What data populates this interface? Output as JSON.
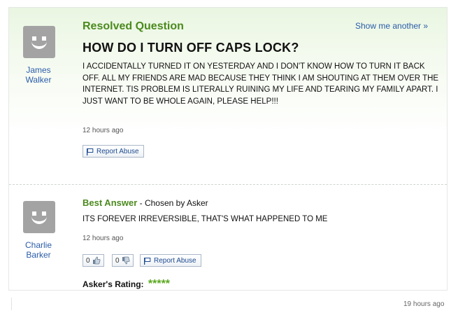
{
  "question": {
    "status_label": "Resolved Question",
    "show_another": "Show me another »",
    "asker": "James Walker",
    "title": "HOW DO I TURN OFF CAPS LOCK?",
    "body": "I ACCIDENTALLY TURNED IT ON YESTERDAY AND I DON'T KNOW HOW TO TURN IT BACK OFF. ALL MY FRIENDS ARE MAD BECAUSE THEY THINK I AM SHOUTING AT THEM OVER THE INTERNET. TIS PROBLEM IS LITERALLY RUINING MY LIFE AND TEARING MY FAMILY APART. I JUST WANT TO BE WHOLE AGAIN, PLEASE HELP!!!",
    "time": "12 hours ago",
    "report_label": "Report Abuse"
  },
  "answer": {
    "answerer": "Charlie Barker",
    "best_label": "Best Answer",
    "chosen_by": " - Chosen by Asker",
    "text": "ITS FOREVER IRREVERSIBLE, THAT'S WHAT HAPPENED TO ME",
    "time": "12 hours ago",
    "thumbs_up_count": "0",
    "thumbs_down_count": "0",
    "report_label": "Report Abuse",
    "rating_label": "Asker's Rating:",
    "rating_stars": "*****",
    "rating_value": 5
  },
  "footer": {
    "time": "19 hours ago"
  },
  "colors": {
    "accent_green": "#4b8a1e",
    "link_blue": "#2a5ca8",
    "star_green": "#5aa81e",
    "avatar_gray": "#a3a3a3"
  },
  "icons": [
    "avatar-icon",
    "flag-icon",
    "thumbs-up-icon",
    "thumbs-down-icon"
  ]
}
